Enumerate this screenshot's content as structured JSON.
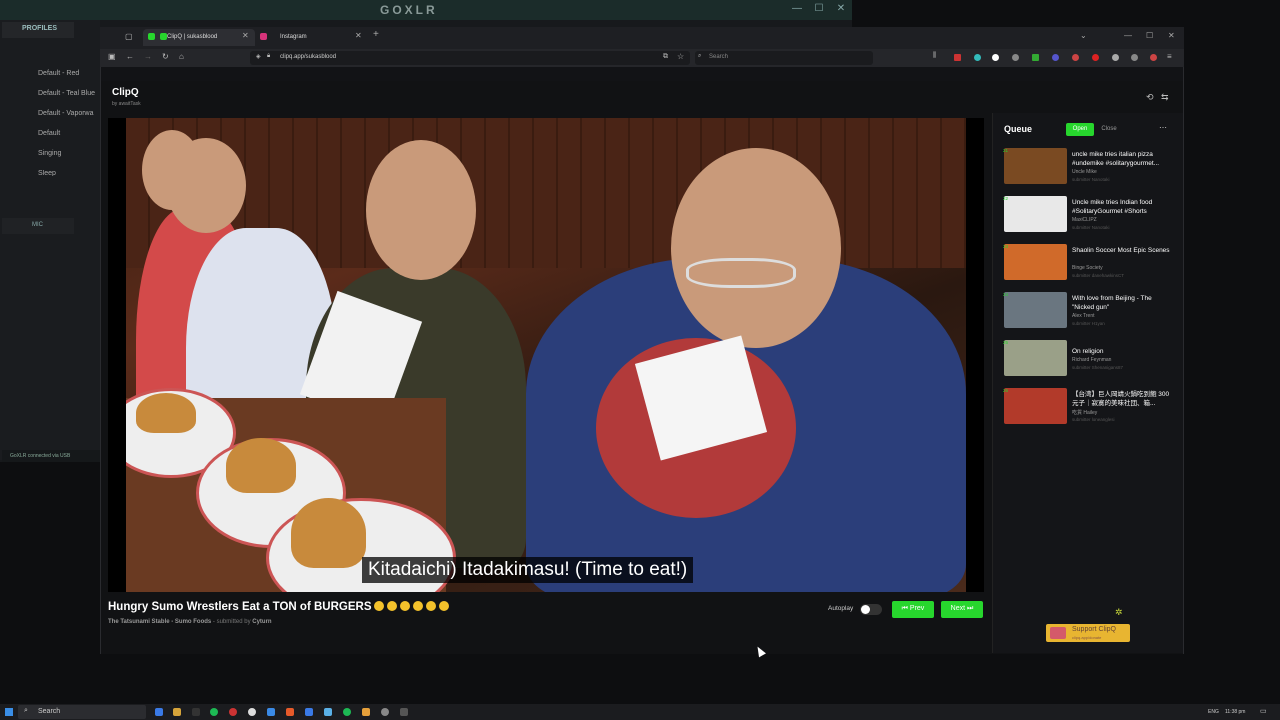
{
  "goxlr": {
    "title": "GOXLR",
    "profiles_label": "PROFILES",
    "profiles": [
      "Default - Red",
      "Default - Teal Blue",
      "Default - Vaporwa",
      "Default",
      "Singing",
      "Sleep"
    ],
    "mic_label": "MIC",
    "status": "GoXLR connected via USB"
  },
  "browser": {
    "tabs": [
      {
        "label": "ClipQ | sukasblood",
        "active": true
      },
      {
        "label": "Instagram",
        "active": false
      }
    ],
    "url": "clipq.app/sukasblood",
    "search_placeholder": "Search"
  },
  "app": {
    "brand": "ClipQ",
    "brand_sub": "by awaitTask"
  },
  "player": {
    "subtitle": "Kitadaichi) Itadakimasu! (Time to eat!)",
    "title": "Hungry Sumo Wrestlers Eat a TON of BURGERS",
    "channel": "The Tatsunami Stable - Sumo Foods",
    "submitted_prefix": "- submitted by",
    "submitter": "Cyturn",
    "autoplay_label": "Autoplay",
    "prev_label": "⏮ Prev",
    "next_label": "Next ⏭"
  },
  "queue": {
    "title": "Queue",
    "open_label": "Open",
    "close_label": "Close",
    "items": [
      {
        "num": "21",
        "title": "uncle mike tries italian pizza #undemike #solitarygourmet...",
        "channel": "Uncle Mike",
        "submitter": "submitter Nanotaki",
        "thumb_color": "#7a4a22"
      },
      {
        "num": "22",
        "title": "Uncle mike tries Indian food #SolitaryGourmet #Shorts",
        "channel": "MaxiCLIPZ",
        "submitter": "submitter Nanotaki",
        "thumb_color": "#e8e8e8"
      },
      {
        "num": "23",
        "title": "Shaolin Soccer Most Epic Scenes",
        "channel": "Binge Society",
        "submitter": "submitter danehawkinsCT",
        "thumb_color": "#d06a2a"
      },
      {
        "num": "24",
        "title": "With love from Beijing - The \"Nicked gun\"",
        "channel": "Alex Trent",
        "submitter": "submitter H1yan",
        "thumb_color": "#6a7680"
      },
      {
        "num": "25",
        "title": "On religion",
        "channel": "Richard Feynman",
        "submitter": "submitter Shenanigans87",
        "thumb_color": "#9aa088"
      },
      {
        "num": "26",
        "title": "【台湾】巨人岡靖火鍋吃到飽 300元子｜寂寞的美味社団、箱...",
        "channel": "吃貨 Hailey",
        "submitter": "submitter loneanglesi",
        "thumb_color": "#b23a2a"
      }
    ],
    "support_label": "Support ClipQ",
    "support_sub": "clipq.app/donate"
  },
  "taskbar": {
    "search_label": "Search",
    "lang": "ENG",
    "time": "11:38 pm"
  },
  "colors": {
    "accent_green": "#27d62d",
    "support_yellow": "#e8b531"
  }
}
